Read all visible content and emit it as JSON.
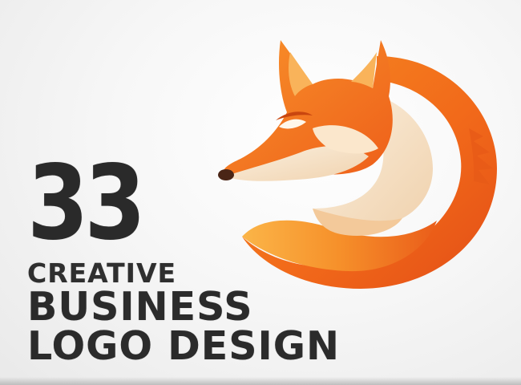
{
  "headline": {
    "number": "33",
    "line1": "CREATIVE",
    "line2": "BUSINESS",
    "line3": "LOGO DESIGN"
  },
  "logo": {
    "name": "fox-logo",
    "colors": {
      "orange_dark": "#e8561b",
      "orange_mid": "#f47a1f",
      "orange_light": "#f9a13a",
      "cream": "#f6e1c4",
      "cream_light": "#fbf0df",
      "nose": "#4a2516"
    }
  }
}
